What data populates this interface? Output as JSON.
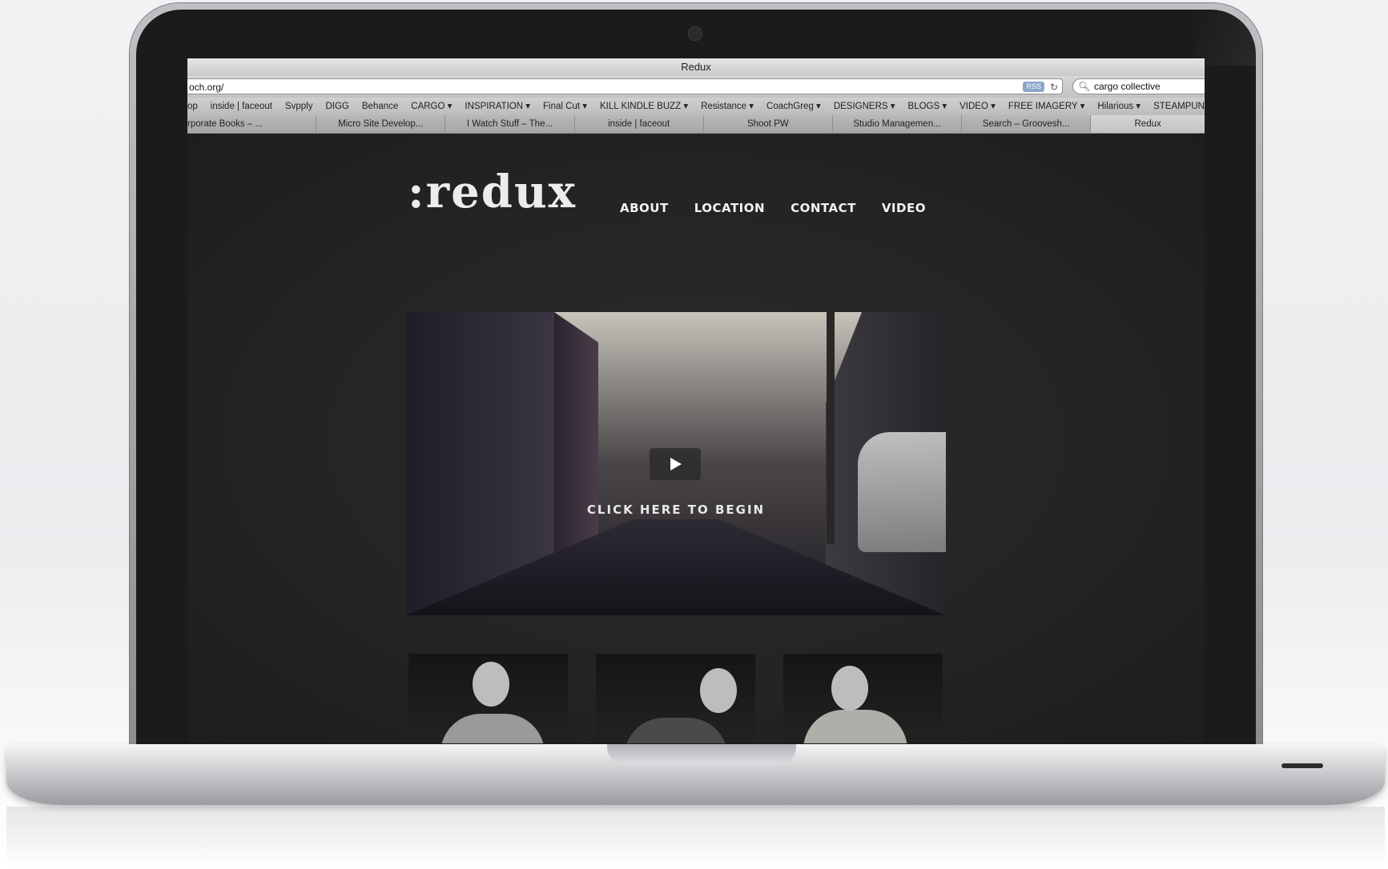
{
  "browser": {
    "window_title": "Redux",
    "url": "och.org/",
    "rss_label": "RSS",
    "reload_icon": "reload-icon",
    "search_value": "cargo collective",
    "bookmarks": [
      "op",
      "inside | faceout",
      "Svpply",
      "DIGG",
      "Behance",
      "CARGO ▾",
      "INSPIRATION ▾",
      "Final Cut ▾",
      "KILL KINDLE BUZZ ▾",
      "Resistance ▾",
      "CoachGreg ▾",
      "DESIGNERS ▾",
      "BLOGS ▾",
      "VIDEO ▾",
      "FREE IMAGERY ▾",
      "Hilarious ▾",
      "STEAMPUNK ▾"
    ],
    "tabs": [
      "rporate Books – ...",
      "Micro Site Develop...",
      "I Watch Stuff – The...",
      "inside | faceout",
      "Shoot PW",
      "Studio Managemen...",
      "Search – Groovesh...",
      "Redux"
    ]
  },
  "site": {
    "logo": ":redux",
    "nav": [
      "ABOUT",
      "LOCATION",
      "CONTACT",
      "VIDEO"
    ],
    "video": {
      "cta": "CLICK HERE TO BEGIN"
    }
  }
}
